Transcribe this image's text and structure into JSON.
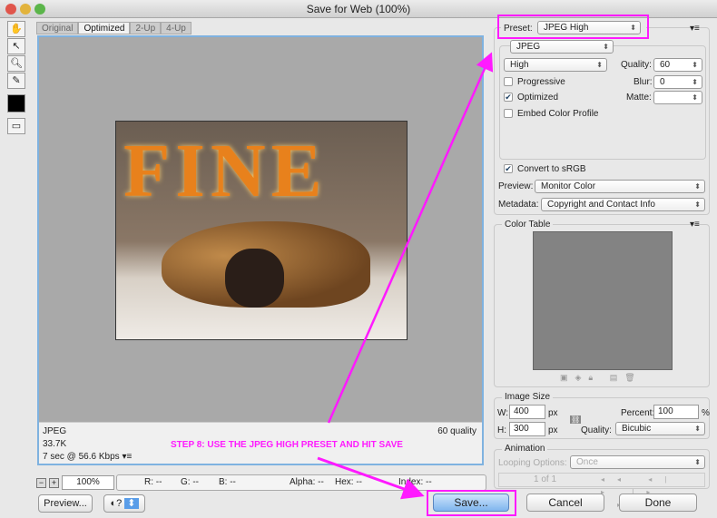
{
  "window": {
    "title": "Save for Web (100%)"
  },
  "tabs": [
    "Original",
    "Optimized",
    "2-Up",
    "4-Up"
  ],
  "tools": [
    "hand-icon",
    "slice-select-icon",
    "zoom-icon",
    "eyedropper-icon",
    "color-swatch",
    "toggle-slices-icon"
  ],
  "preview": {
    "format": "JPEG",
    "size": "33.7K",
    "time": "7 sec @ 56.6 Kbps",
    "quality": "60 quality",
    "photo_text": "FINE"
  },
  "annotation": {
    "text": "STEP 8: USE THE JPEG HIGH PRESET AND HIT SAVE",
    "color": "#ff1aff"
  },
  "statusbar": {
    "zoom": "100%",
    "r": "R: --",
    "g": "G: --",
    "b": "B: --",
    "alpha": "Alpha: --",
    "hex": "Hex: --",
    "index": "Index: --"
  },
  "settings": {
    "preset_label": "Preset:",
    "preset": "JPEG High",
    "format": "JPEG",
    "compression": "High",
    "quality_label": "Quality:",
    "quality": "60",
    "blur_label": "Blur:",
    "blur": "0",
    "matte_label": "Matte:",
    "matte": "",
    "progressive": {
      "label": "Progressive",
      "checked": false
    },
    "optimized": {
      "label": "Optimized",
      "checked": true
    },
    "embed": {
      "label": "Embed Color Profile",
      "checked": false
    },
    "srgb": {
      "label": "Convert to sRGB",
      "checked": true
    },
    "preview_label": "Preview:",
    "preview_value": "Monitor Color",
    "metadata_label": "Metadata:",
    "metadata_value": "Copyright and Contact Info"
  },
  "color_table": {
    "title": "Color Table"
  },
  "image_size": {
    "title": "Image Size",
    "w_label": "W:",
    "w": "400",
    "h_label": "H:",
    "h": "300",
    "unit": "px",
    "percent_label": "Percent:",
    "percent": "100",
    "percent_unit": "%",
    "quality_label": "Quality:",
    "quality": "Bicubic"
  },
  "animation": {
    "title": "Animation",
    "looping_label": "Looping Options:",
    "looping": "Once",
    "frame": "1 of 1"
  },
  "buttons": {
    "preview": "Preview...",
    "save": "Save...",
    "cancel": "Cancel",
    "done": "Done"
  }
}
